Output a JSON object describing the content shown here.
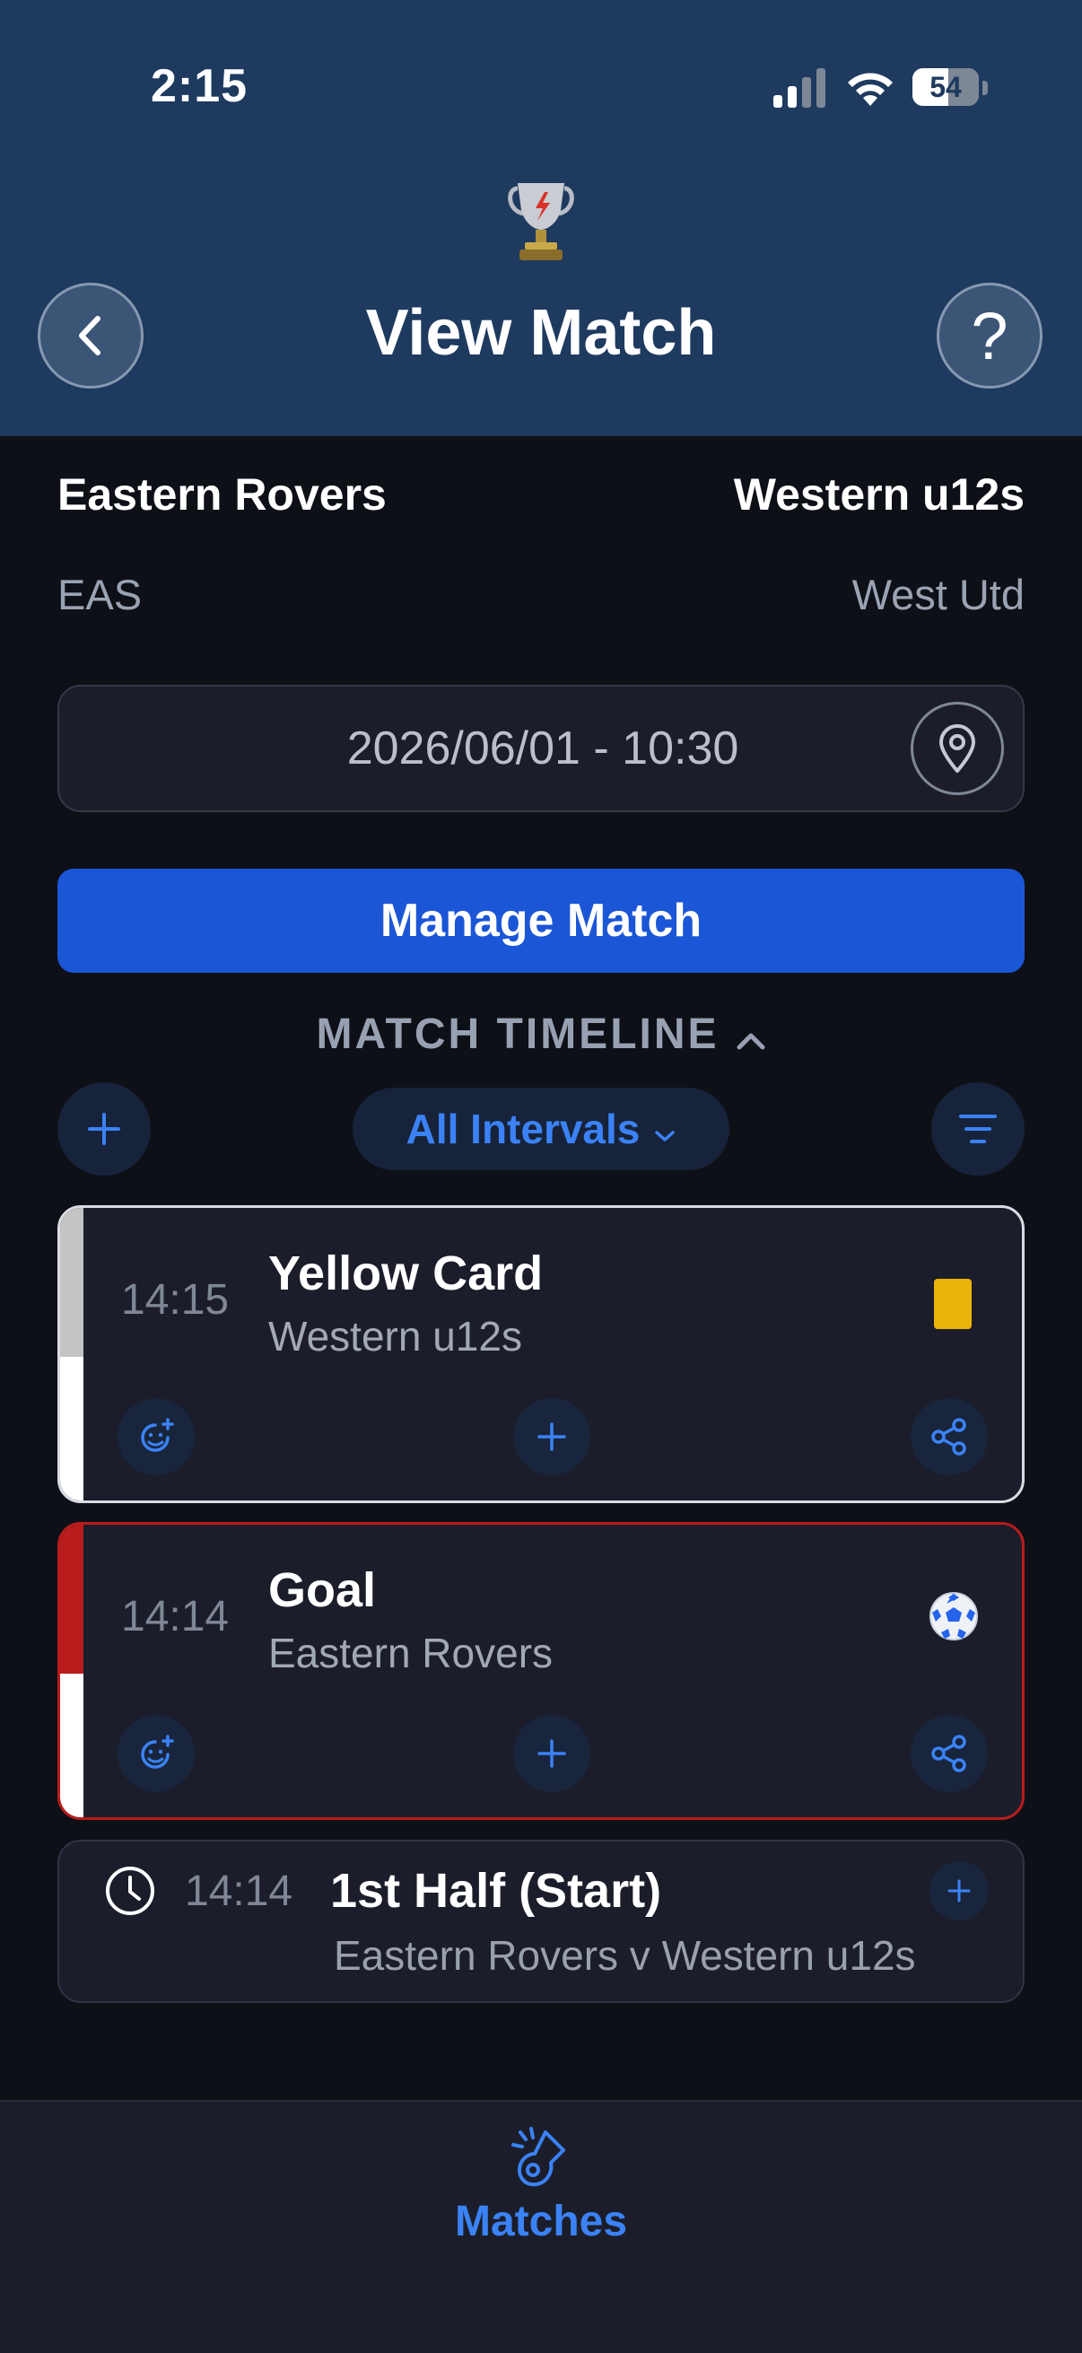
{
  "status_bar": {
    "time": "2:15",
    "battery": "54",
    "battery_level": 0.54
  },
  "header": {
    "title": "View Match",
    "help_label": "?"
  },
  "match": {
    "home_team": "Eastern Rovers",
    "home_short": "EAS",
    "away_team": "Western u12s",
    "away_short": "West Utd",
    "datetime": "2026/06/01 - 10:30"
  },
  "actions": {
    "manage_label": "Manage Match"
  },
  "timeline": {
    "header": "MATCH TIMELINE",
    "filter_label": "All Intervals",
    "events": [
      {
        "time": "14:15",
        "title": "Yellow Card",
        "team": "Western u12s",
        "stripe_color": "#c4c4c4",
        "border_color": "#d9dce2"
      },
      {
        "time": "14:14",
        "title": "Goal",
        "team": "Eastern Rovers",
        "stripe_color": "#b91c1c",
        "border_color": "#b91c1c"
      }
    ],
    "period": {
      "time": "14:14",
      "title": "1st Half (Start)",
      "subtitle": "Eastern Rovers v Western u12s"
    }
  },
  "tabbar": {
    "label": "Matches"
  },
  "colors": {
    "accent": "#3b82f6",
    "primary_button": "#1b56d6",
    "header_bg": "#1e3a5f",
    "yellow_card": "#eab308"
  }
}
